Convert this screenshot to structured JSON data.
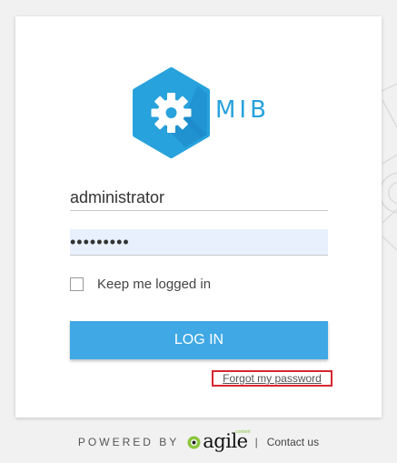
{
  "brand": {
    "name": "MIB",
    "accent_color": "#27a2dc",
    "logo_icon": "gear-icon"
  },
  "login_form": {
    "username_value": "administrator",
    "password_value": "•••••••••",
    "remember_label": "Keep me logged in",
    "remember_checked": false,
    "login_button_label": "LOG IN",
    "forgot_password_label": "Forgot my password"
  },
  "footer": {
    "powered_by_label": "POWERED BY",
    "partner_logo_text": "agile",
    "partner_logo_subtext": "content",
    "separator": "|",
    "contact_label": "Contact us"
  },
  "colors": {
    "button": "#3fa8e5",
    "highlight_border": "#d7262f",
    "password_field_bg": "#e8f0fe"
  }
}
